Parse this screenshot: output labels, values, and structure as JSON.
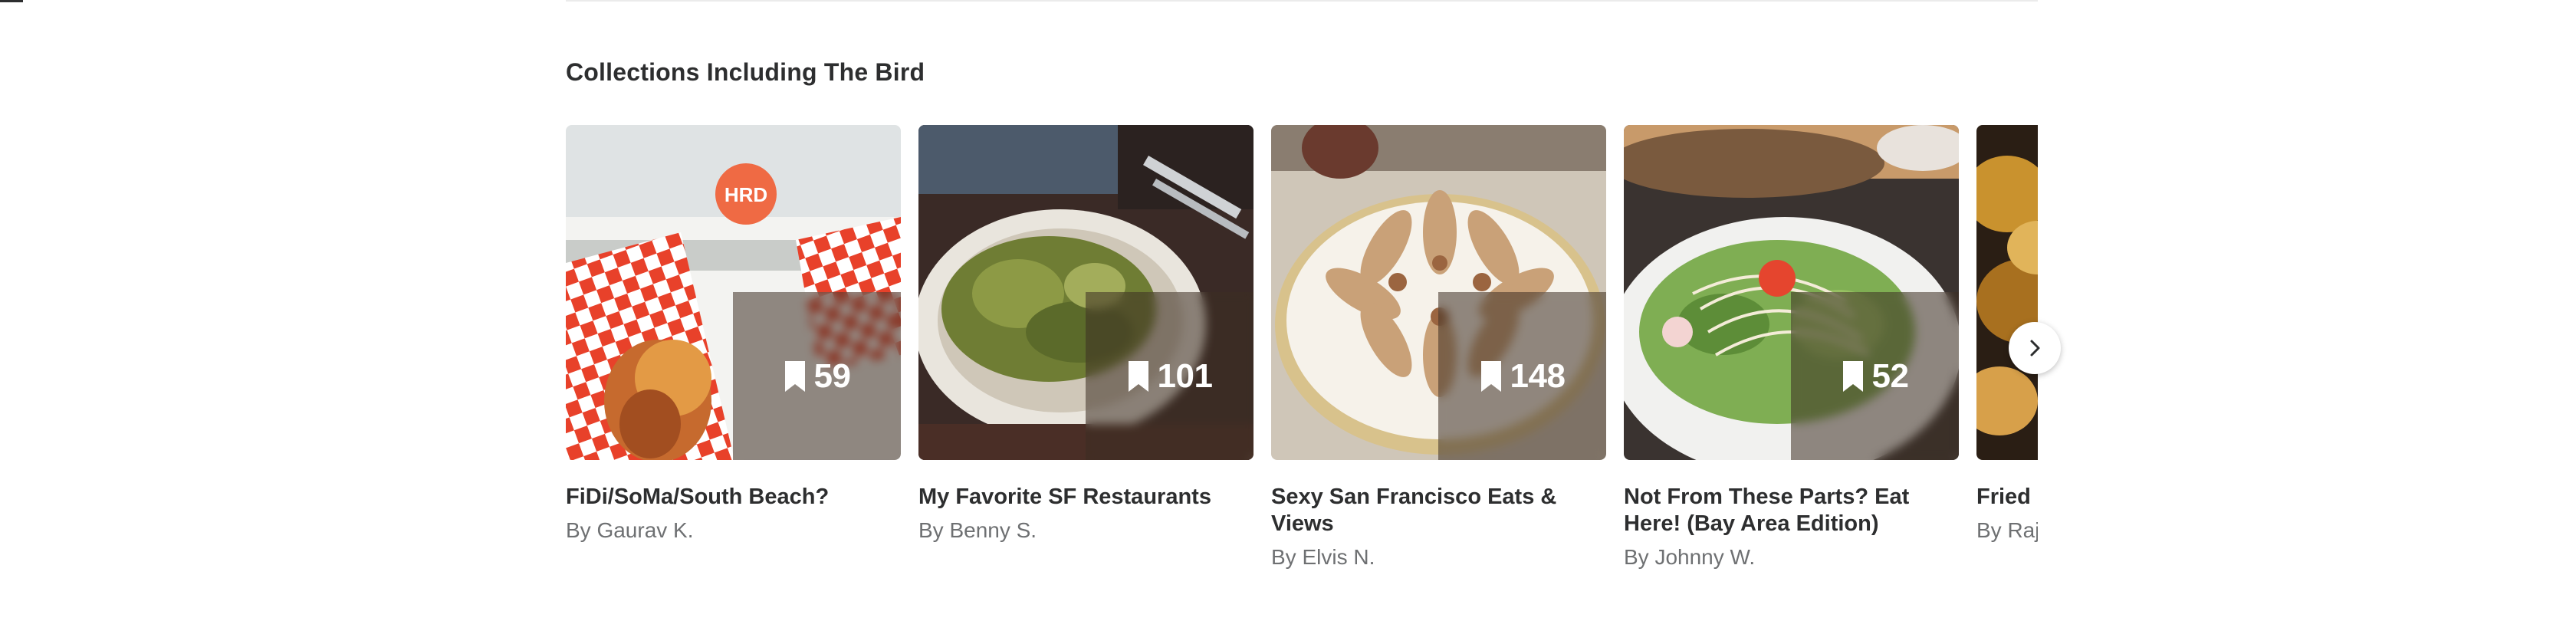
{
  "section": {
    "title": "Collections Including The Bird"
  },
  "collections": [
    {
      "title": "FiDi/SoMa/South Beach?",
      "author": "By Gaurav K.",
      "bookmarks": "59"
    },
    {
      "title": "My Favorite SF Restaurants",
      "author": "By Benny S.",
      "bookmarks": "101"
    },
    {
      "title": "Sexy San Francisco Eats & Views",
      "author": "By Elvis N.",
      "bookmarks": "148"
    },
    {
      "title": "Not From These Parts? Eat Here! (Bay Area Edition)",
      "author": "By Johnny W.",
      "bookmarks": "52"
    },
    {
      "title": "Fried C",
      "author": "By Raj",
      "bookmarks": ""
    }
  ],
  "icons": {
    "bookmark": "bookmark-icon",
    "next": "chevron-right-icon"
  },
  "colors": {
    "text": "#2d2e2f",
    "muted": "#6e7072",
    "overlay": "#3c2d23"
  }
}
